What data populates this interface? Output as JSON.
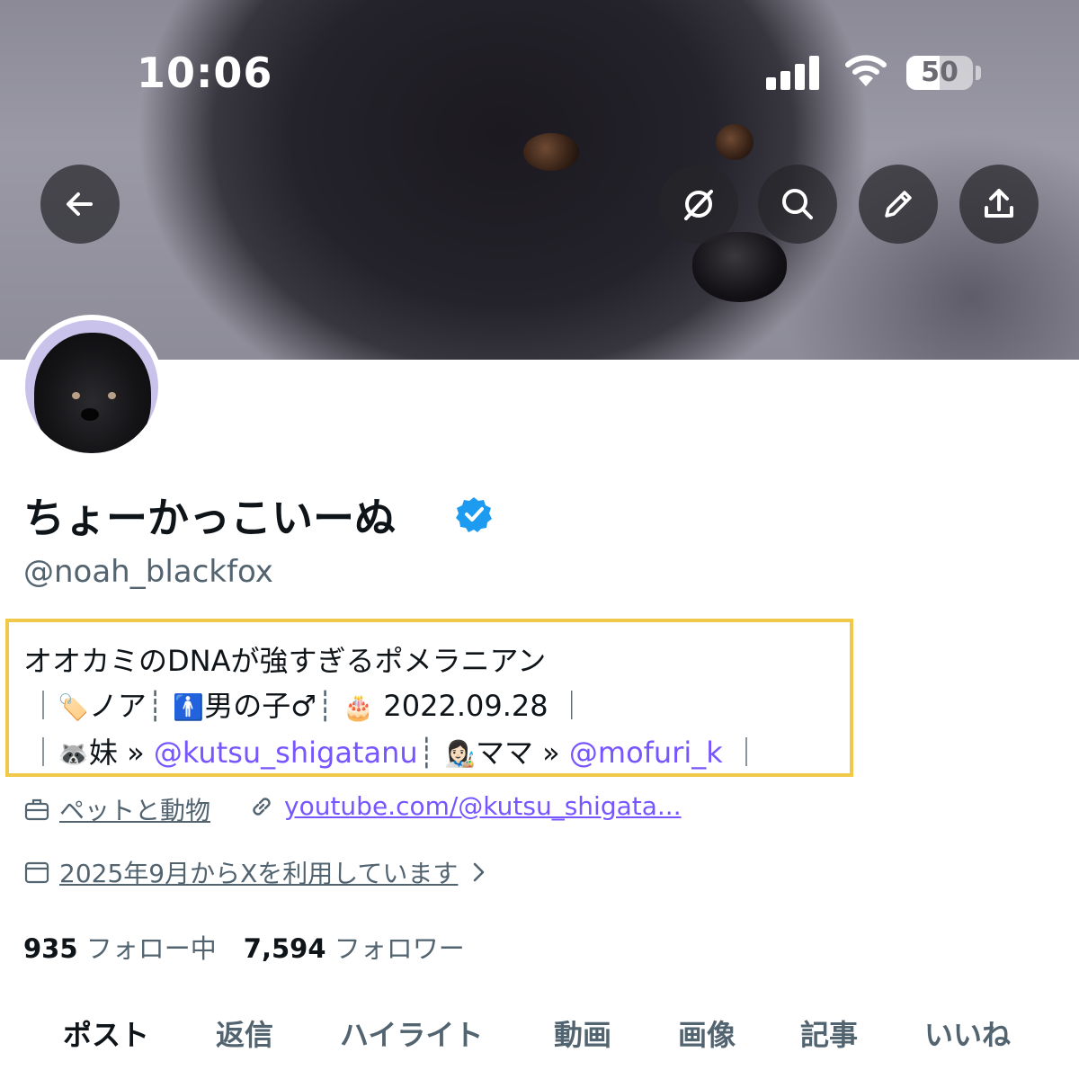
{
  "status_bar": {
    "time": "10:06",
    "battery_level": "50",
    "battery_fraction": 0.5
  },
  "header": {
    "buttons": [
      "back-arrow-icon",
      "grok-icon",
      "search-icon",
      "edit-icon",
      "share-icon"
    ]
  },
  "profile": {
    "display_name": "ちょーかっこいーぬ",
    "verified": true,
    "handle": "@noah_blackfox",
    "bio": {
      "line1": "オオカミのDNAが強すぎるポメラニアン",
      "line2": {
        "name_emoji": "🏷️",
        "name": "ノア",
        "gender_emoji": "🚹",
        "gender": "男の子♂",
        "birthday_emoji": "🎂",
        "birthday": "2022.09.28"
      },
      "line3": {
        "sister_emoji": "🦝",
        "sister_label": "妹 »",
        "sister_handle": "@kutsu_shigatanu",
        "mama_emoji": "👩🏻‍🎨",
        "mama_label": "ママ »",
        "mama_handle": "@mofuri_k"
      },
      "sep_bar": "｜",
      "sep_dot": "┊"
    },
    "category": "ペットと動物",
    "website": "youtube.com/@kutsu_shigata...",
    "joined": "2025年9月からXを利用しています",
    "following_count": "935",
    "following_label": "フォロー中",
    "followers_count": "7,594",
    "followers_label": "フォロワー"
  },
  "tabs": [
    "ポスト",
    "返信",
    "ハイライト",
    "動画",
    "画像",
    "記事",
    "いいね"
  ],
  "active_tab": "ポスト",
  "colors": {
    "accent": "#7856ff",
    "secondary_text": "#536471",
    "highlight_border": "#f0c84a",
    "verified": "#1d9bf0"
  }
}
